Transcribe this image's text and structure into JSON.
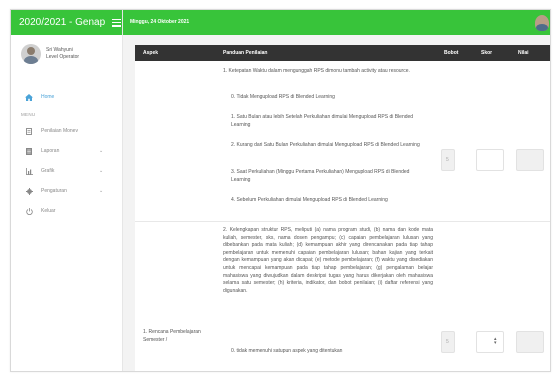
{
  "sidebar": {
    "brand": "2020/2021 - Genap",
    "user_name": "Sri Wahyuni",
    "user_role": "Level Operator",
    "menu_label": "MENU",
    "items": [
      {
        "label": "Home"
      },
      {
        "label": "Penilaian Monev"
      },
      {
        "label": "Laporan"
      },
      {
        "label": "Grafik"
      },
      {
        "label": "Pengaturan"
      },
      {
        "label": "Keluar"
      }
    ]
  },
  "topbar": {
    "date": "Minggu, 24 Oktober 2021"
  },
  "table": {
    "headers": {
      "aspek": "Aspek",
      "panduan": "Panduan Penilaian",
      "bobot": "Bobot",
      "skor": "Skor",
      "nilai": "Nilai"
    },
    "row1": {
      "intro": "1. Ketepatan Waktu dalam mengunggah RPS dimonu tambah activity atau resource.",
      "options": [
        "0. Tidak Mengupload RPS di Blended Learning",
        "1. Satu Bulan atau lebih Setelah Perkuliahan dimulai Mengupload RPS di Blended Learning",
        "2. Kurang dari Satu Bulan Perkuliahan dimulai Mengupload RPS di Blended Learning",
        "3. Saat Perkuliahan (Minggu Pertama Perkuliahan) Mengupload RPS di Blended Learning",
        "4. Sebelum Perkuliahan dimulai Mengupload RPS di Blended Learning"
      ],
      "bobot": "5"
    },
    "row2": {
      "aspek": "1. Rencana Pembelajaran Semester /",
      "text": "2. Kelengkapan struktur RPS, meliputi (a) nama program studi, (b) nama dan kode mata kuliah, semester, sks, nama dosen pengampu; (c) capaian pembelajaran lulusan yang dibebankan pada mata kuliah; (d) kemampuan akhir yang direncanakan pada tiap tahap pembelajaran untuk memenuhi capaian pembelajaran lulusan; bahan kajian yang terkait dengan kemampuan yang akan dicapai; (e) metode pembelajaran; (f) waktu yang disediakan untuk mencapai kemampuan pada tiap tahap pembelajaran; (g) pengalaman belajar mahasiswa yang diwujudkan dalam deskripsi tugas yang harus dikerjakan oleh mahasiswa selama satu semester; (h) kriteria, indikator, dan bobot penilaian; (i) daftar referensi yang digunakan.",
      "trailing": "0. tidak memenuhi satupun aspek yang ditentukan",
      "bobot": "5"
    }
  }
}
